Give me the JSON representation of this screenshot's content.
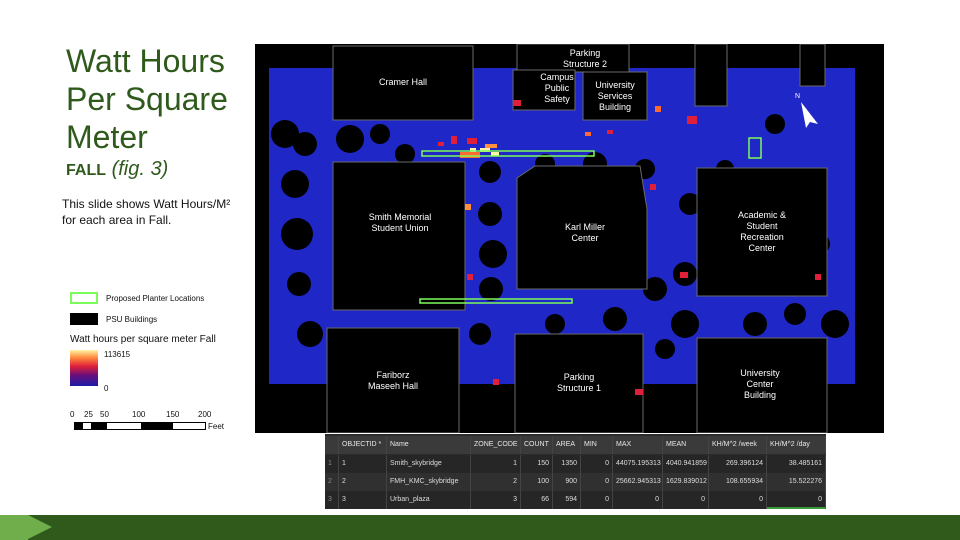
{
  "slide": {
    "title": "Watt Hours Per Square Meter",
    "subtitle_bold": "FALL",
    "subtitle_italic": "(fig. 3)",
    "description": "This slide shows Watt Hours/M²  for each area in Fall."
  },
  "legend": {
    "planter_label": "Proposed Planter Locations",
    "buildings_label": "PSU Buildings",
    "raster_title": "Watt hours per square meter Fall",
    "raster_max": "113615",
    "raster_min": "0",
    "scale_ticks": [
      "0",
      "25",
      "50",
      "100",
      "150",
      "200"
    ],
    "scale_unit": "Feet",
    "colors": {
      "planter": "#7cfc5a",
      "buildings": "#000000",
      "low": "#1a1aa8",
      "high": "#fff4a8"
    }
  },
  "map": {
    "buildings": [
      {
        "name": "Cramer Hall",
        "lines": [
          "Cramer Hall"
        ]
      },
      {
        "name": "Parking Structure 2",
        "lines": [
          "Parking",
          "Structure 2"
        ]
      },
      {
        "name": "Campus Public Safety",
        "lines": [
          "Campus",
          "Public",
          "Safety"
        ]
      },
      {
        "name": "University Services Building",
        "lines": [
          "University",
          "Services",
          "Building"
        ]
      },
      {
        "name": "Smith Memorial Student Union",
        "lines": [
          "Smith Memorial",
          "Student Union"
        ]
      },
      {
        "name": "Karl Miller Center",
        "lines": [
          "Karl Miller",
          "Center"
        ]
      },
      {
        "name": "Academic & Student Recreation Center",
        "lines": [
          "Academic &",
          "Student",
          "Recreation",
          "Center"
        ]
      },
      {
        "name": "Fariborz Maseeh Hall",
        "lines": [
          "Fariborz",
          "Maseeh Hall"
        ]
      },
      {
        "name": "Parking Structure 1",
        "lines": [
          "Parking",
          "Structure 1"
        ]
      },
      {
        "name": "University Center Building",
        "lines": [
          "University",
          "Center",
          "Building"
        ]
      }
    ],
    "north_label": "N"
  },
  "table": {
    "headers": [
      "",
      "OBJECTID *",
      "Name",
      "ZONE_CODE",
      "COUNT",
      "AREA",
      "MIN",
      "MAX",
      "MEAN",
      "KH/M^2 /week",
      "KH/M^2 /day"
    ],
    "rows": [
      [
        "1",
        "1",
        "Smith_skybridge",
        "1",
        "150",
        "1350",
        "0",
        "44075.195313",
        "4040.941859",
        "269.396124",
        "38.485161"
      ],
      [
        "2",
        "2",
        "FMH_KMC_skybridge",
        "2",
        "100",
        "900",
        "0",
        "25662.945313",
        "1629.839012",
        "108.655934",
        "15.522276"
      ],
      [
        "3",
        "3",
        "Urban_plaza",
        "3",
        "66",
        "594",
        "0",
        "0",
        "0",
        "0",
        "0"
      ]
    ]
  }
}
